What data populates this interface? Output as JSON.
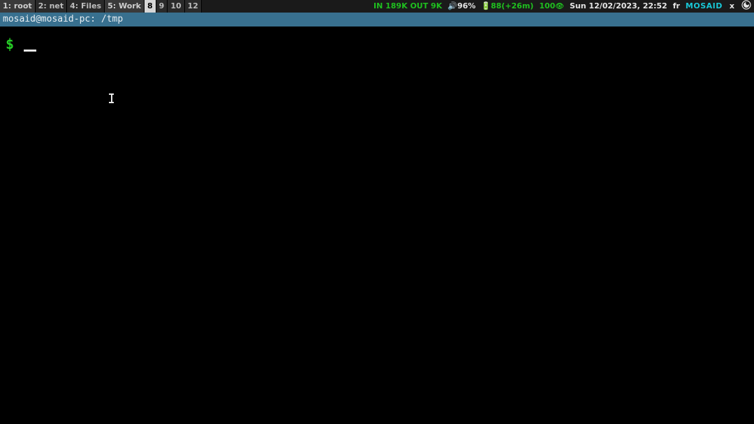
{
  "topbar": {
    "workspaces": [
      {
        "id": "ws1",
        "label": "1: root",
        "active": false,
        "dim": false
      },
      {
        "id": "ws2",
        "label": "2: net",
        "active": false,
        "dim": true
      },
      {
        "id": "ws4",
        "label": "4: Files",
        "active": false,
        "dim": true
      },
      {
        "id": "ws5",
        "label": "5: Work",
        "active": false,
        "dim": false
      },
      {
        "id": "ws8",
        "label": "8",
        "active": true,
        "dim": false
      },
      {
        "id": "ws9",
        "label": "9",
        "active": false,
        "dim": true
      },
      {
        "id": "ws10",
        "label": "10",
        "active": false,
        "dim": true
      },
      {
        "id": "ws12",
        "label": "12",
        "active": false,
        "dim": true
      }
    ],
    "net": "IN 189K OUT 9K",
    "vol": "🔊96%",
    "battery": "🔋88(+26m)",
    "bright": "100",
    "bright_icon": "👁",
    "datetime": "Sun 12/02/2023, 22:52",
    "lang": "fr",
    "brand": "MOSAID",
    "tray_x": "x"
  },
  "titlebar": "mosaid@mosaid-pc: /tmp",
  "terminal": {
    "prompt": "$"
  }
}
